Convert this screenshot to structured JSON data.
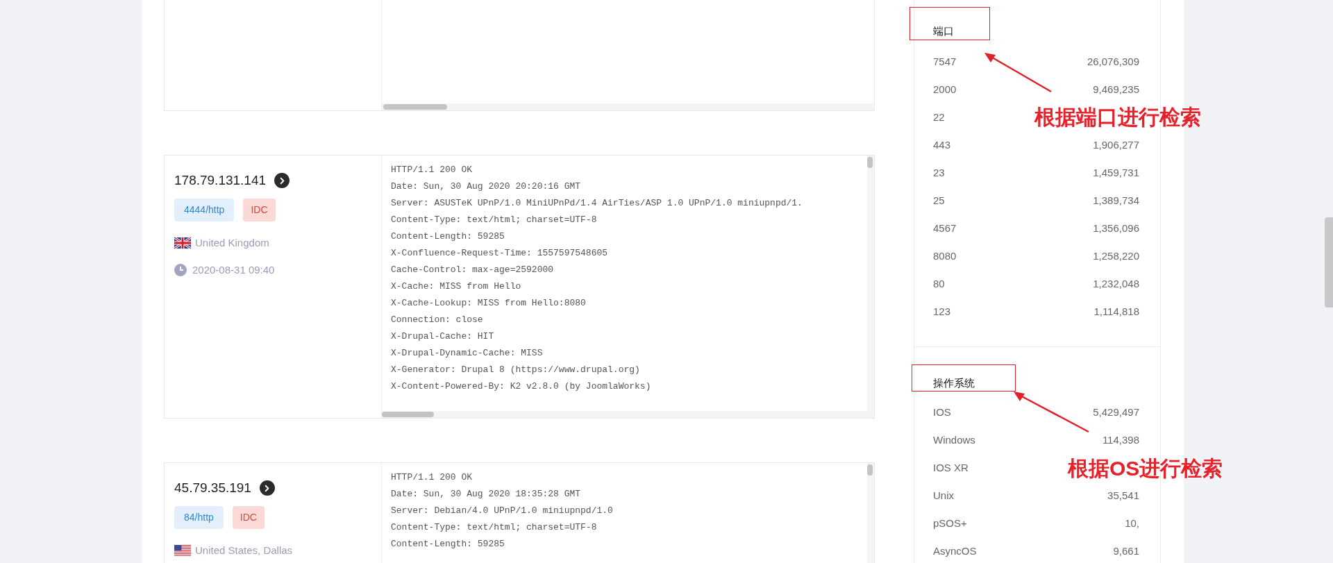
{
  "hosts": [
    {
      "ip": "178.79.131.141",
      "service": "4444/http",
      "tag": "IDC",
      "location": {
        "kind": "uk",
        "text": "United Kingdom"
      },
      "time": "2020-08-31 09:40",
      "response": [
        "HTTP/1.1 200 OK",
        "Date: Sun, 30 Aug 2020 20:20:16 GMT",
        "Server: ASUSTeK UPnP/1.0 MiniUPnPd/1.4 AirTies/ASP 1.0 UPnP/1.0 miniupnpd/1.",
        "Content-Type: text/html; charset=UTF-8",
        "Content-Length: 59285",
        "X-Confluence-Request-Time: 1557597548605",
        "Cache-Control: max-age=2592000",
        "X-Cache: MISS from Hello",
        "X-Cache-Lookup: MISS from Hello:8080",
        "Connection: close",
        "X-Drupal-Cache: HIT",
        "X-Drupal-Dynamic-Cache: MISS",
        "X-Generator: Drupal 8 (https://www.drupal.org)",
        "X-Content-Powered-By: K2 v2.8.0 (by JoomlaWorks)"
      ]
    },
    {
      "ip": "45.79.35.191",
      "service": "84/http",
      "tag": "IDC",
      "location": {
        "kind": "us",
        "text": "United States, Dallas"
      },
      "response": [
        "HTTP/1.1 200 OK",
        "Date: Sun, 30 Aug 2020 18:35:28 GMT",
        "Server: Debian/4.0 UPnP/1.0 miniupnpd/1.0",
        "Content-Type: text/html; charset=UTF-8",
        "Content-Length: 59285"
      ]
    }
  ],
  "sidebar": [
    {
      "title": "端口",
      "rows": [
        {
          "label": "7547",
          "count": "26,076,309"
        },
        {
          "label": "2000",
          "count": "9,469,235"
        },
        {
          "label": "22"
        },
        {
          "label": "443",
          "count": "1,906,277"
        },
        {
          "label": "23",
          "count": "1,459,731"
        },
        {
          "label": "25",
          "count": "1,389,734"
        },
        {
          "label": "4567",
          "count": "1,356,096"
        },
        {
          "label": "8080",
          "count": "1,258,220"
        },
        {
          "label": "80",
          "count": "1,232,048"
        },
        {
          "label": "123",
          "count": "1,114,818"
        }
      ]
    },
    {
      "title": "操作系统",
      "rows": [
        {
          "label": "IOS",
          "count": "5,429,497"
        },
        {
          "label": "Windows",
          "count": "114,398"
        },
        {
          "label": "IOS XR"
        },
        {
          "label": "Unix",
          "count": "35,541"
        },
        {
          "label": "pSOS+",
          "count": "10,"
        },
        {
          "label": "AsyncOS",
          "count": "9,661"
        }
      ]
    }
  ],
  "annotations": [
    {
      "label": "根据端口进行检索"
    },
    {
      "label": "根据OS进行检索"
    }
  ]
}
